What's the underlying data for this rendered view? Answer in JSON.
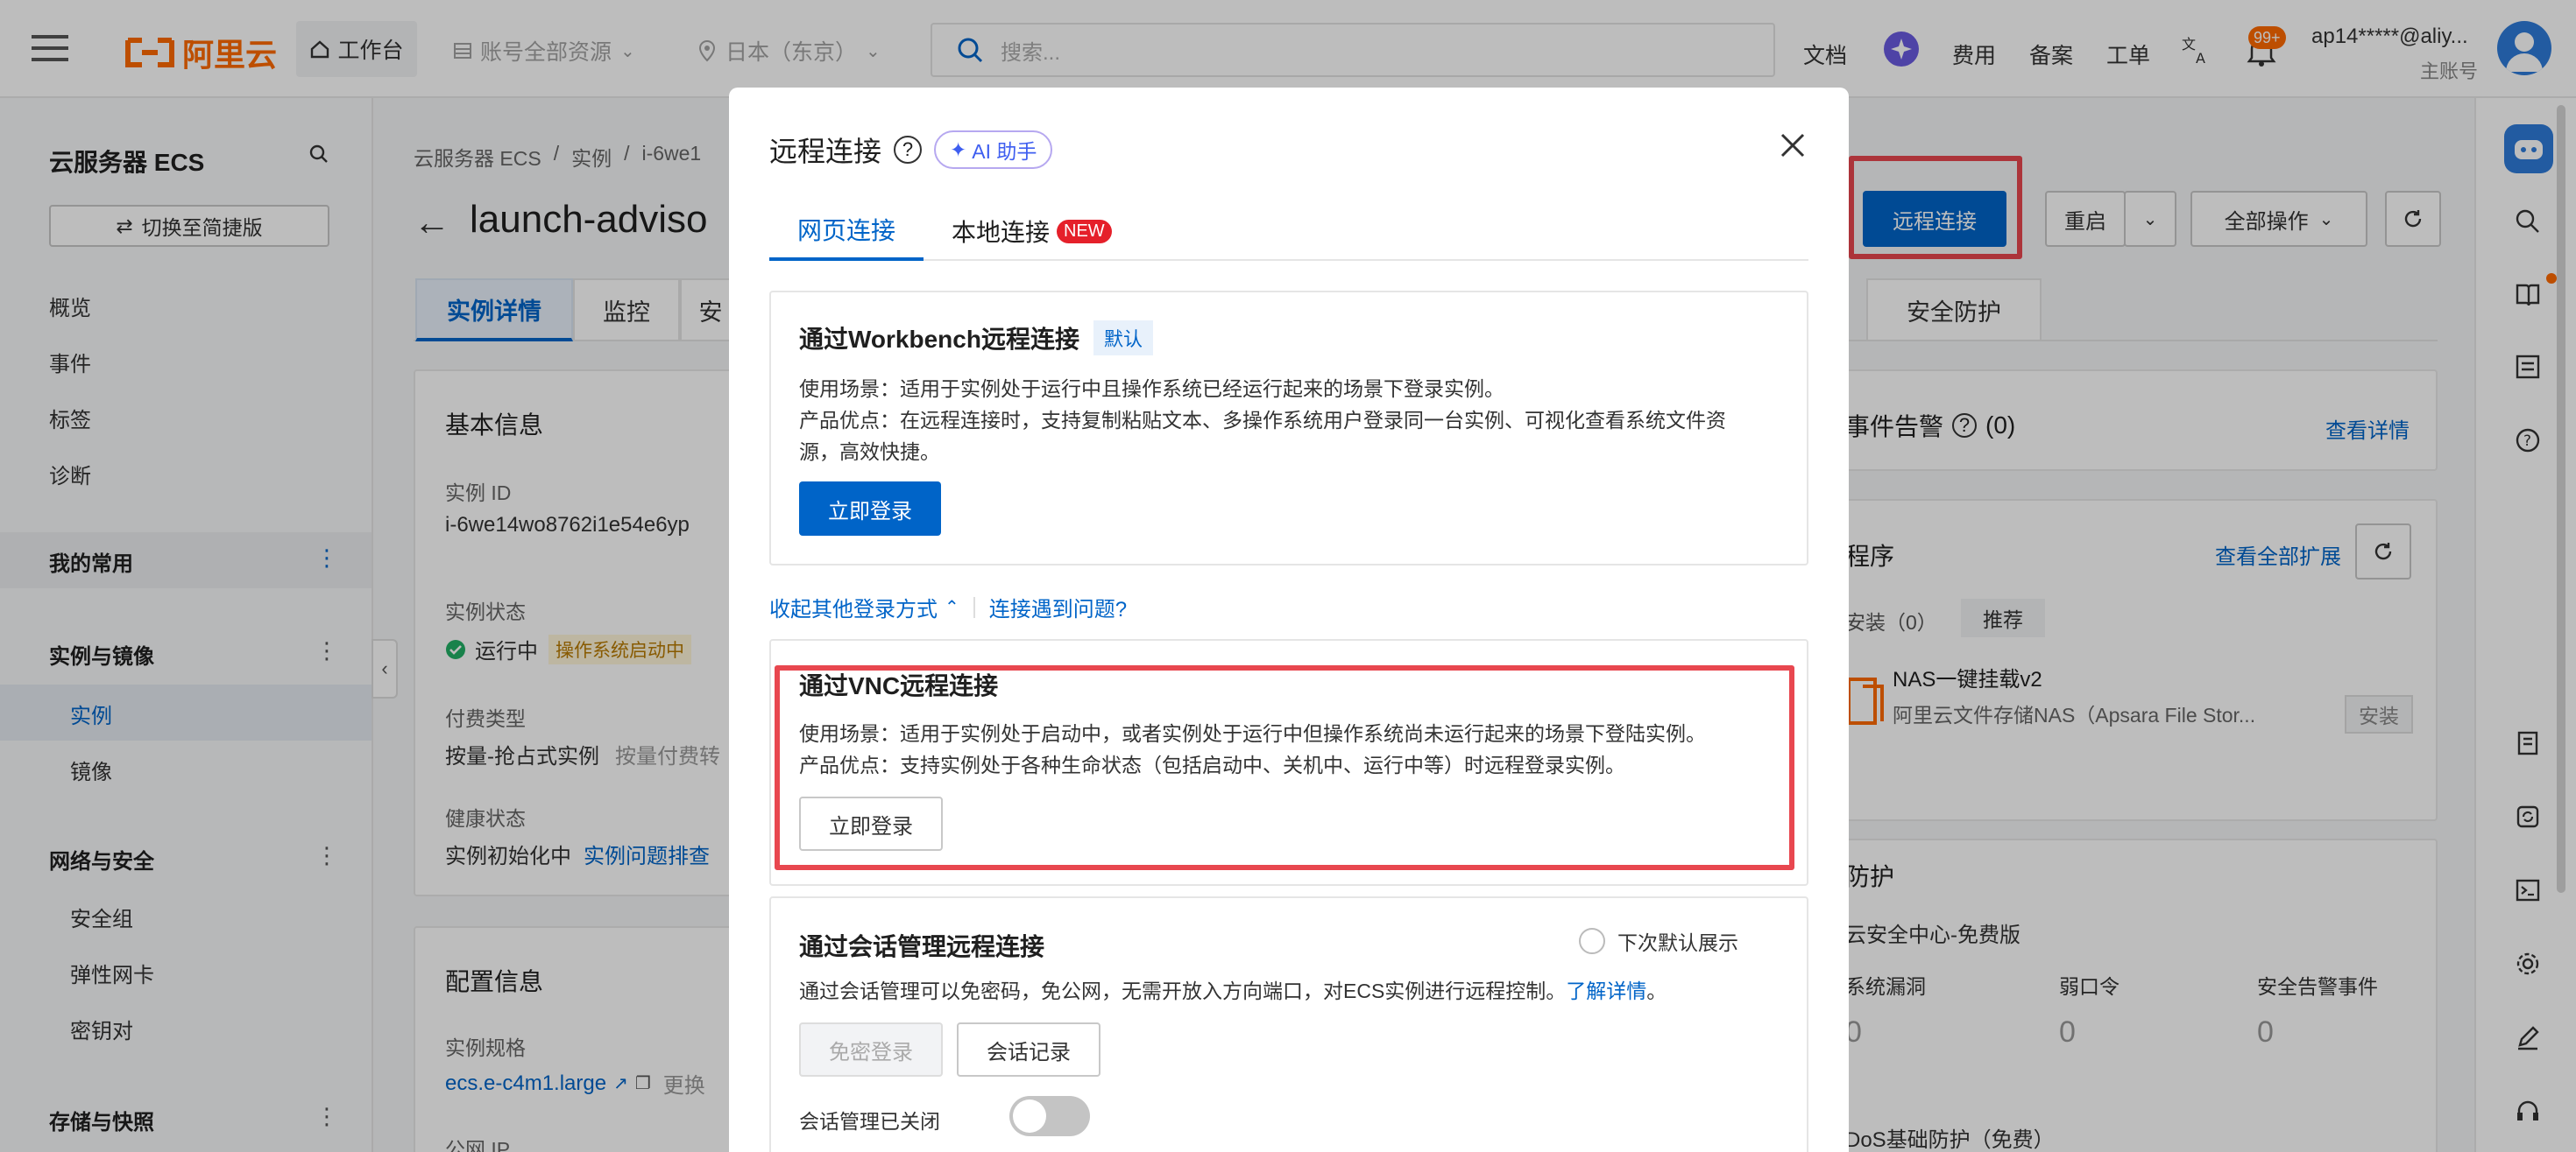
{
  "topbar": {
    "logo_text": "阿里云",
    "workbench": "工作台",
    "resource_scope": "账号全部资源",
    "region": "日本（东京）",
    "search_placeholder": "搜索...",
    "links": [
      "文档",
      "费用",
      "备案",
      "工单"
    ],
    "notification_badge": "99+",
    "user_account": "ap14*****@aliy...",
    "user_role": "主账号"
  },
  "sidebar": {
    "title": "云服务器 ECS",
    "switch_btn": "切换至简捷版",
    "items": [
      "概览",
      "事件",
      "标签",
      "诊断"
    ],
    "my_common": "我的常用",
    "group_instances": "实例与镜像",
    "instances": "实例",
    "images": "镜像",
    "group_network": "网络与安全",
    "security_group": "安全组",
    "eni": "弹性网卡",
    "key_pair": "密钥对",
    "group_storage": "存储与快照"
  },
  "main": {
    "breadcrumb": [
      "云服务器 ECS",
      "/",
      "实例",
      "/",
      "i-6we1"
    ],
    "page_title": "launch-adviso",
    "tabs": [
      "实例详情",
      "监控",
      "安",
      "安全防护"
    ],
    "basic_info": {
      "title": "基本信息",
      "instance_id_label": "实例 ID",
      "instance_id": "i-6we14wo8762i1e54e6yp",
      "status_label": "实例状态",
      "status": "运行中",
      "status_tag": "操作系统启动中",
      "billing_label": "付费类型",
      "billing": "按量-抢占式实例",
      "billing_extra": "按量付费转",
      "health_label": "健康状态",
      "health": "实例初始化中",
      "health_link": "实例问题排查"
    },
    "config_info": {
      "title": "配置信息",
      "spec_label": "实例规格",
      "spec": "ecs.e-c4m1.large",
      "spec_extra": "更换",
      "ip_label": "公网 IP"
    },
    "actions": {
      "remote": "远程连接",
      "restart": "重启",
      "all_ops": "全部操作"
    },
    "right_cards": {
      "events_title": "事件告警",
      "events_count": "(0)",
      "view_details": "查看详情",
      "program_title": "程序",
      "view_all_ext": "查看全部扩展",
      "installed": "安装（0）",
      "recommend": "推荐",
      "nas_name": "NAS一键挂载v2",
      "nas_desc": "阿里云文件存储NAS（Apsara File Stor...",
      "install": "安装",
      "protect_title": "防护",
      "sec_center": "云安全中心-免费版",
      "metric_labels": [
        "系统漏洞",
        "弱口令",
        "安全告警事件"
      ],
      "metric_values": [
        "0",
        "0",
        "0"
      ],
      "ddos": "DoS基础防护（免费）"
    }
  },
  "modal": {
    "title": "远程连接",
    "ai_btn": "AI 助手",
    "tab_web": "网页连接",
    "tab_local": "本地连接",
    "new_badge": "NEW",
    "workbench": {
      "title": "通过Workbench远程连接",
      "default_tag": "默认",
      "scene": "使用场景：适用于实例处于运行中且操作系统已经运行起来的场景下登录实例。",
      "advantage_1": "产品优点：在远程连接时，支持复制粘贴文本、多操作系统用户登录同一台实例、可视化查看系统文件资",
      "advantage_2": "源，高效快捷。",
      "login_btn": "立即登录"
    },
    "collapse_link": "收起其他登录方式",
    "problem_link": "连接遇到问题?",
    "vnc": {
      "title": "通过VNC远程连接",
      "scene": "使用场景：适用于实例处于启动中，或者实例处于运行中但操作系统尚未运行起来的场景下登陆实例。",
      "advantage": "产品优点：支持实例处于各种生命状态（包括启动中、关机中、运行中等）时远程登录实例。",
      "login_btn": "立即登录"
    },
    "session": {
      "title": "通过会话管理远程连接",
      "default_next": "下次默认展示",
      "desc": "通过会话管理可以免密码，免公网，无需开放入方向端口，对ECS实例进行远程控制。",
      "learn_more": "了解详情",
      "period": "。",
      "pwdless_btn": "免密登录",
      "record_btn": "会话记录",
      "toggle_label": "会话管理已关闭"
    }
  },
  "colors": {
    "accent": "#0064c8",
    "brand": "#ff6a00",
    "highlight": "#e8474f",
    "running": "#23b066"
  }
}
